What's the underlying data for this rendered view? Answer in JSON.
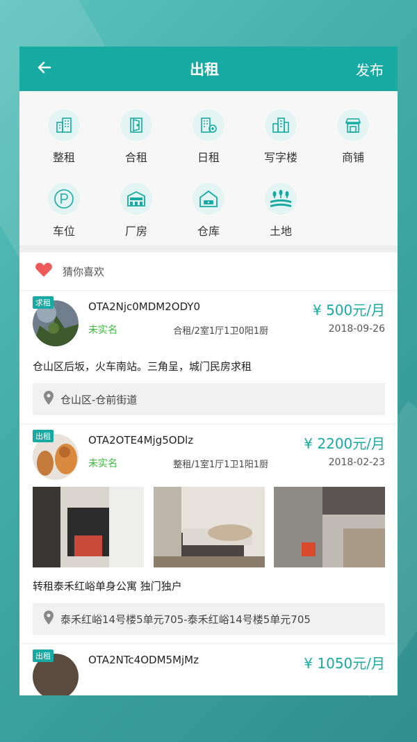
{
  "header": {
    "title": "出租",
    "publish": "发布"
  },
  "categories": [
    {
      "label": "整租",
      "icon": "building-icon"
    },
    {
      "label": "合租",
      "icon": "door-icon"
    },
    {
      "label": "日租",
      "icon": "calendar-building-icon"
    },
    {
      "label": "写字楼",
      "icon": "office-icon"
    },
    {
      "label": "商铺",
      "icon": "shop-icon"
    },
    {
      "label": "车位",
      "icon": "parking-icon"
    },
    {
      "label": "厂房",
      "icon": "factory-icon"
    },
    {
      "label": "仓库",
      "icon": "warehouse-icon"
    },
    {
      "label": "土地",
      "icon": "land-icon"
    }
  ],
  "guess": {
    "label": "猜你喜欢"
  },
  "listings": [
    {
      "badge": "求租",
      "user": "OTA2Njc0MDM2ODY0",
      "verify": "未实名",
      "price": "¥ 500元/月",
      "spec": "合租/2室1厅1卫0阳1厨",
      "date": "2018-09-26",
      "desc": "仓山区后坂，火车南站。三角呈，城门民房求租",
      "address": "仓山区-仓前街道"
    },
    {
      "badge": "出租",
      "user": "OTA2OTE4Mjg5ODlz",
      "verify": "未实名",
      "price": "¥ 2200元/月",
      "spec": "整租/1室1厅1卫1阳1厨",
      "date": "2018-02-23",
      "desc": "转租泰禾红峪单身公寓 独门独户",
      "address": "泰禾红峪14号楼5单元705-泰禾红峪14号楼5单元705"
    },
    {
      "badge": "出租",
      "user": "OTA2NTc4ODM5MjMz",
      "price": "¥ 1050元/月"
    }
  ],
  "colors": {
    "accent": "#16aaa3",
    "verify": "#3cbc3c",
    "heart": "#ee5a5a"
  }
}
